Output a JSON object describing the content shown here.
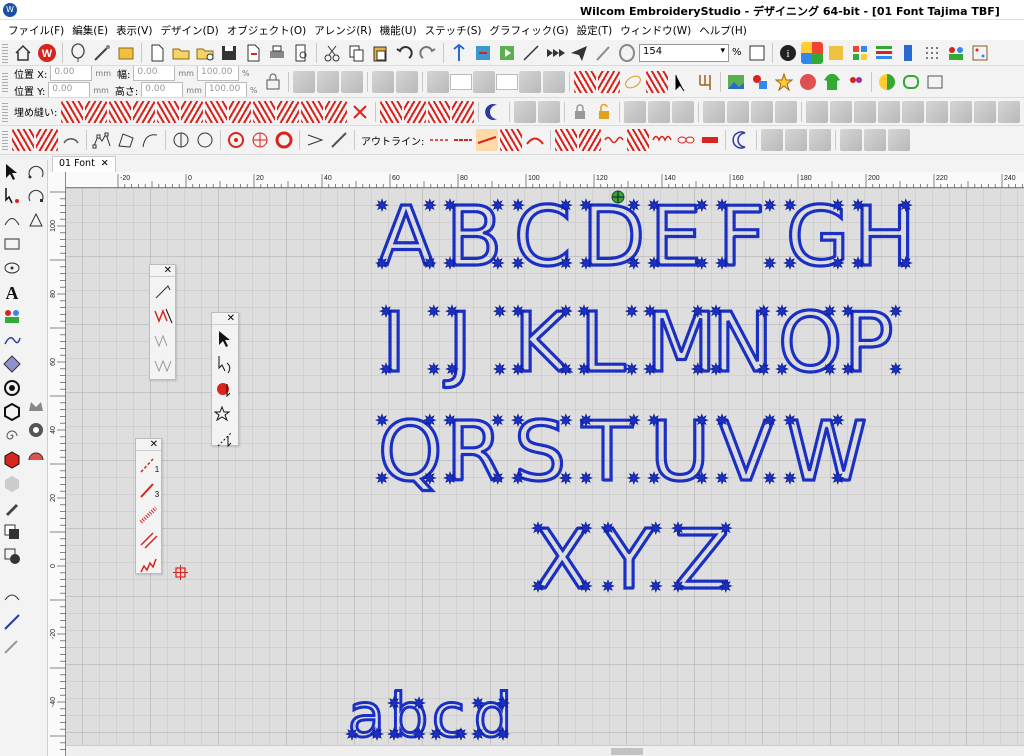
{
  "titlebar": {
    "title": "Wilcom EmbroideryStudio - デザイニング 64-bit - [01 Font     Tajima TBF]"
  },
  "menu": [
    "ファイル(F)",
    "編集(E)",
    "表示(V)",
    "デザイン(D)",
    "オブジェクト(O)",
    "アレンジ(R)",
    "機能(U)",
    "ステッチ(S)",
    "グラフィック(G)",
    "設定(T)",
    "ウィンドウ(W)",
    "ヘルプ(H)"
  ],
  "toolbar": {
    "zoom_value": "154",
    "zoom_unit": "%"
  },
  "position_bar": {
    "pos_x_label": "位置 X:",
    "pos_y_label": "位置 Y:",
    "width_label": "幅:",
    "height_label": "高さ:",
    "pos_x": "0.00",
    "pos_y": "0.00",
    "width": "0.00",
    "height": "0.00",
    "unit_mm": "mm",
    "scale_w": "100.00",
    "scale_h": "100.00",
    "unit_pct": "%"
  },
  "fill_bar": {
    "label": "埋め縫い:"
  },
  "outline_bar": {
    "label": "アウトライン:"
  },
  "tab": {
    "label": "01 Font",
    "close": "✕"
  },
  "ruler": {
    "h_ticks": [
      "-20",
      "0",
      "20",
      "40",
      "60",
      "80",
      "100",
      "120",
      "140",
      "160",
      "180",
      "200",
      "220",
      "240"
    ],
    "v_ticks": [
      "100",
      "80",
      "60",
      "40",
      "20",
      "0",
      "-20",
      "-40"
    ]
  },
  "palettes": {
    "close": "✕",
    "numbered_items": [
      "1",
      "3"
    ]
  },
  "canvas_text": {
    "row1": "ABCDEFGH",
    "row2": "IJKLMNOP",
    "row3": "QRSTUVW",
    "row4": "XYZ",
    "row5": "abcd"
  },
  "colors": {
    "stitch": "#1a2fc4",
    "stitch_outline": "#0a1a8a",
    "accent_red": "#d9231d",
    "grid": "#bdbdbd",
    "canvas_bg": "#dedede"
  }
}
